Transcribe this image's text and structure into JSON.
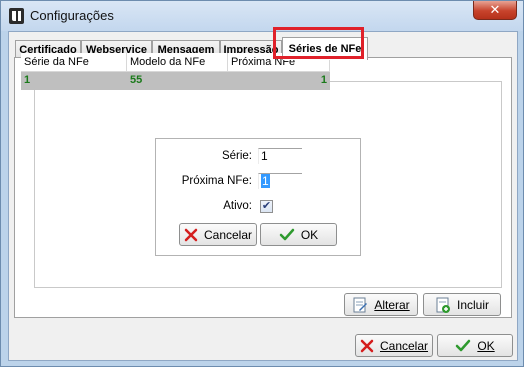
{
  "window": {
    "title": "Configurações",
    "close_glyph": "✕",
    "icon": "app-logo-icon"
  },
  "tabs": [
    {
      "label": "Certificado",
      "active": false
    },
    {
      "label": "Webservice",
      "active": false
    },
    {
      "label": "Mensagem",
      "active": false
    },
    {
      "label": "Impressão",
      "active": false
    },
    {
      "label": "Séries de NFe",
      "active": true
    }
  ],
  "grid": {
    "columns": [
      "Série da NFe",
      "Modelo da NFe",
      "Próxima NFe"
    ],
    "rows": [
      [
        "1",
        "55",
        "1"
      ]
    ]
  },
  "form": {
    "serie_label": "Série:",
    "serie_value": "1",
    "proxima_label": "Próxima NFe:",
    "proxima_value": "1",
    "ativo_label": "Ativo:",
    "ativo_checked": true,
    "check_glyph": "✔",
    "cancel_label": "Cancelar",
    "ok_label": "OK"
  },
  "panel_buttons": {
    "alterar_label": "Alterar",
    "incluir_label": "Incluir"
  },
  "dialog_buttons": {
    "cancel_label": "Cancelar",
    "ok_label": "OK"
  },
  "colors": {
    "highlight": "#e0212a",
    "grid_value": "#1b7a1b",
    "cancel_icon": "#d41d1d",
    "ok_icon": "#2e9a2e"
  }
}
